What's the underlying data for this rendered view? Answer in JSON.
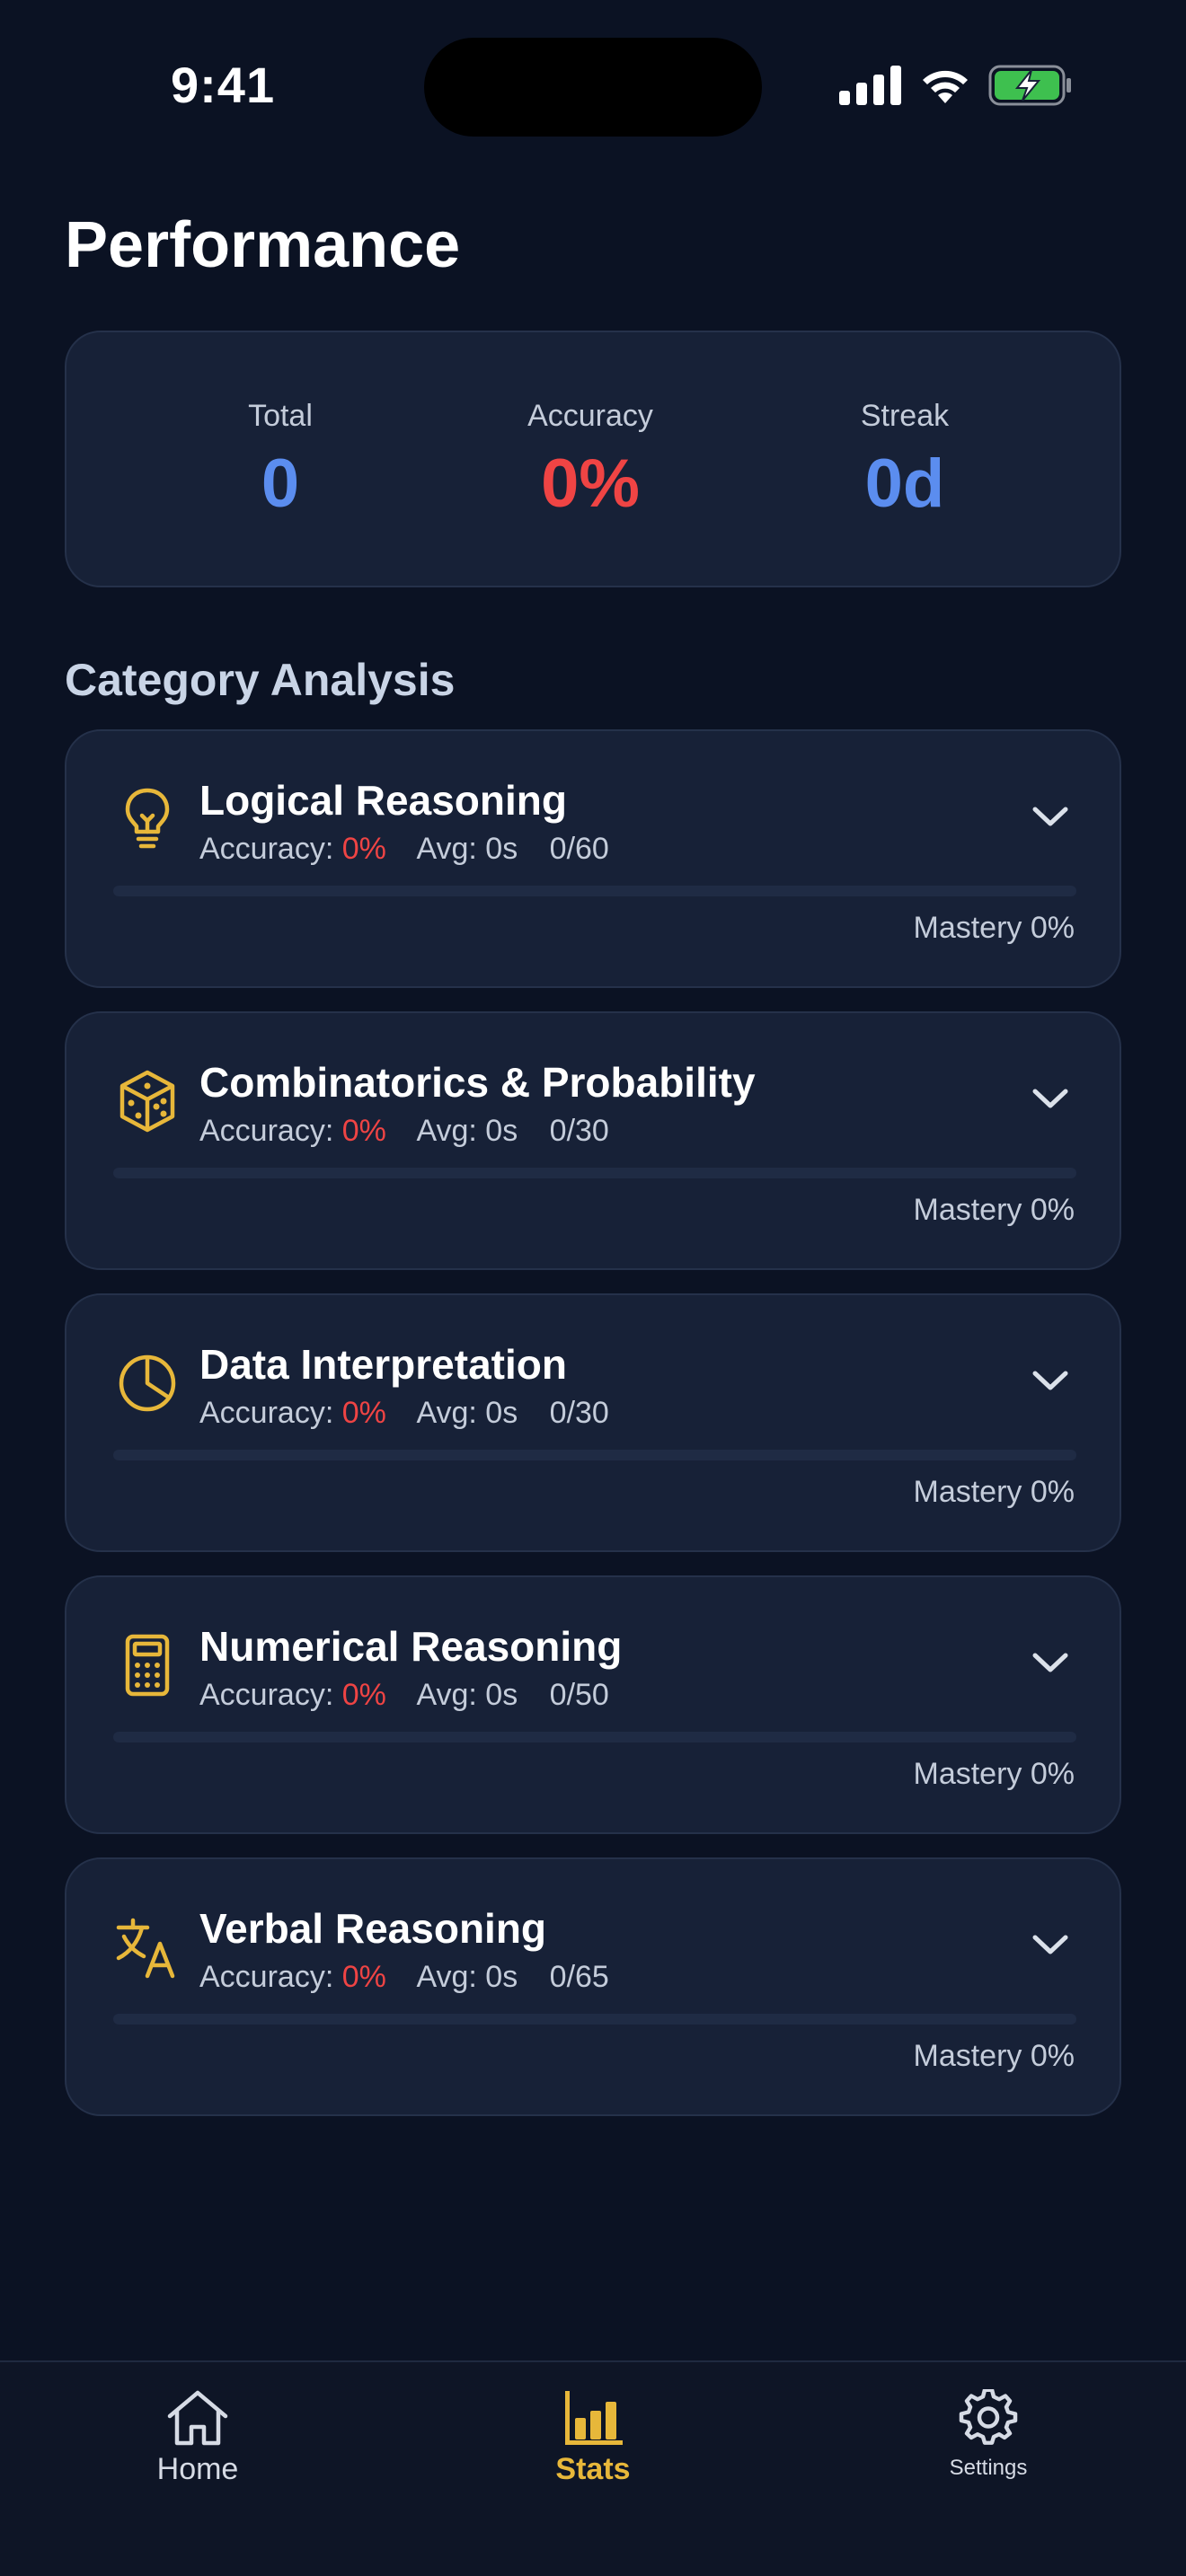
{
  "status_bar": {
    "time": "9:41"
  },
  "page": {
    "title": "Performance"
  },
  "summary": {
    "total": {
      "label": "Total",
      "value": "0"
    },
    "accuracy": {
      "label": "Accuracy",
      "value": "0%"
    },
    "streak": {
      "label": "Streak",
      "value": "0d"
    }
  },
  "section": {
    "title": "Category Analysis"
  },
  "categories": [
    {
      "name": "Logical Reasoning",
      "icon": "lightbulb-icon",
      "accuracy_label": "Accuracy:",
      "accuracy": "0%",
      "avg": "Avg: 0s",
      "progress": "0/60",
      "mastery": "Mastery 0%",
      "mastery_fraction": 0
    },
    {
      "name": "Combinatorics & Probability",
      "icon": "dice-icon",
      "accuracy_label": "Accuracy:",
      "accuracy": "0%",
      "avg": "Avg: 0s",
      "progress": "0/30",
      "mastery": "Mastery 0%",
      "mastery_fraction": 0
    },
    {
      "name": "Data Interpretation",
      "icon": "pie-chart-icon",
      "accuracy_label": "Accuracy:",
      "accuracy": "0%",
      "avg": "Avg: 0s",
      "progress": "0/30",
      "mastery": "Mastery 0%",
      "mastery_fraction": 0
    },
    {
      "name": "Numerical Reasoning",
      "icon": "calculator-icon",
      "accuracy_label": "Accuracy:",
      "accuracy": "0%",
      "avg": "Avg: 0s",
      "progress": "0/50",
      "mastery": "Mastery 0%",
      "mastery_fraction": 0
    },
    {
      "name": "Verbal Reasoning",
      "icon": "translate-icon",
      "accuracy_label": "Accuracy:",
      "accuracy": "0%",
      "avg": "Avg: 0s",
      "progress": "0/65",
      "mastery": "Mastery 0%",
      "mastery_fraction": 0
    }
  ],
  "tab_bar": {
    "home": {
      "label": "Home",
      "icon": "home-icon"
    },
    "stats": {
      "label": "Stats",
      "icon": "bar-chart-icon"
    },
    "settings": {
      "label": "Settings",
      "icon": "gear-icon"
    }
  },
  "colors": {
    "background": "#0b1223",
    "card": "#172137",
    "accent": "#e7b73a",
    "blue": "#5b8def",
    "red": "#ef4444"
  }
}
